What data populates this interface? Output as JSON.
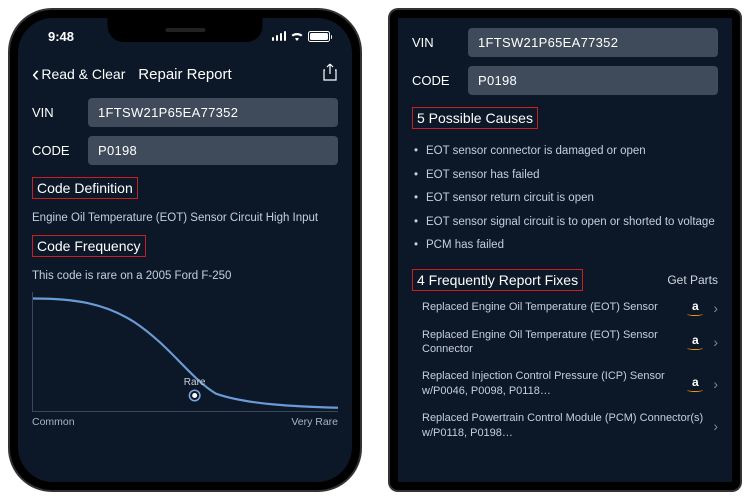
{
  "statusbar": {
    "time": "9:48"
  },
  "nav": {
    "back": "Read & Clear",
    "title": "Repair Report"
  },
  "fields": {
    "vin_label": "VIN",
    "vin": "1FTSW21P65EA77352",
    "code_label": "CODE",
    "code": "P0198"
  },
  "sections": {
    "definition_title": "Code Definition",
    "definition_text": "Engine Oil Temperature (EOT) Sensor Circuit High Input",
    "frequency_title": "Code Frequency",
    "frequency_text": "This code is rare on a 2005 Ford F-250",
    "causes_title": "5 Possible Causes",
    "fixes_title": "4 Frequently Report Fixes",
    "get_parts": "Get Parts"
  },
  "causes": [
    "EOT sensor connector is damaged or open",
    "EOT sensor has failed",
    "EOT sensor return circuit is open",
    "EOT sensor signal circuit is to open or shorted to voltage",
    "PCM has failed"
  ],
  "fixes": [
    "Replaced Engine Oil Temperature (EOT) Sensor",
    "Replaced Engine Oil Temperature (EOT) Sensor Connector",
    "Replaced Injection Control Pressure (ICP) Sensor w/P0046, P0098, P0118…",
    "Replaced Powertrain Control Module (PCM) Connector(s) w/P0118, P0198…"
  ],
  "chart_data": {
    "type": "line",
    "title": "Code Frequency",
    "xlabel_left": "Common",
    "xlabel_right": "Very Rare",
    "marker_label": "Rare",
    "marker_x": 0.55,
    "x": [
      0,
      0.1,
      0.2,
      0.3,
      0.4,
      0.5,
      0.6,
      0.7,
      0.8,
      0.9,
      1.0
    ],
    "values": [
      1.0,
      0.98,
      0.92,
      0.75,
      0.48,
      0.24,
      0.12,
      0.06,
      0.03,
      0.015,
      0.01
    ],
    "ylim": [
      0,
      1
    ]
  }
}
